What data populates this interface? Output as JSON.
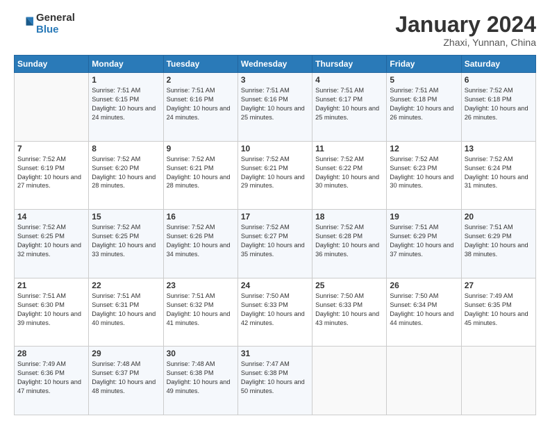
{
  "header": {
    "logo_line1": "General",
    "logo_line2": "Blue",
    "month_title": "January 2024",
    "location": "Zhaxi, Yunnan, China"
  },
  "days_of_week": [
    "Sunday",
    "Monday",
    "Tuesday",
    "Wednesday",
    "Thursday",
    "Friday",
    "Saturday"
  ],
  "weeks": [
    [
      {
        "day": "",
        "sunrise": "",
        "sunset": "",
        "daylight": ""
      },
      {
        "day": "1",
        "sunrise": "Sunrise: 7:51 AM",
        "sunset": "Sunset: 6:15 PM",
        "daylight": "Daylight: 10 hours and 24 minutes."
      },
      {
        "day": "2",
        "sunrise": "Sunrise: 7:51 AM",
        "sunset": "Sunset: 6:16 PM",
        "daylight": "Daylight: 10 hours and 24 minutes."
      },
      {
        "day": "3",
        "sunrise": "Sunrise: 7:51 AM",
        "sunset": "Sunset: 6:16 PM",
        "daylight": "Daylight: 10 hours and 25 minutes."
      },
      {
        "day": "4",
        "sunrise": "Sunrise: 7:51 AM",
        "sunset": "Sunset: 6:17 PM",
        "daylight": "Daylight: 10 hours and 25 minutes."
      },
      {
        "day": "5",
        "sunrise": "Sunrise: 7:51 AM",
        "sunset": "Sunset: 6:18 PM",
        "daylight": "Daylight: 10 hours and 26 minutes."
      },
      {
        "day": "6",
        "sunrise": "Sunrise: 7:52 AM",
        "sunset": "Sunset: 6:18 PM",
        "daylight": "Daylight: 10 hours and 26 minutes."
      }
    ],
    [
      {
        "day": "7",
        "sunrise": "Sunrise: 7:52 AM",
        "sunset": "Sunset: 6:19 PM",
        "daylight": "Daylight: 10 hours and 27 minutes."
      },
      {
        "day": "8",
        "sunrise": "Sunrise: 7:52 AM",
        "sunset": "Sunset: 6:20 PM",
        "daylight": "Daylight: 10 hours and 28 minutes."
      },
      {
        "day": "9",
        "sunrise": "Sunrise: 7:52 AM",
        "sunset": "Sunset: 6:21 PM",
        "daylight": "Daylight: 10 hours and 28 minutes."
      },
      {
        "day": "10",
        "sunrise": "Sunrise: 7:52 AM",
        "sunset": "Sunset: 6:21 PM",
        "daylight": "Daylight: 10 hours and 29 minutes."
      },
      {
        "day": "11",
        "sunrise": "Sunrise: 7:52 AM",
        "sunset": "Sunset: 6:22 PM",
        "daylight": "Daylight: 10 hours and 30 minutes."
      },
      {
        "day": "12",
        "sunrise": "Sunrise: 7:52 AM",
        "sunset": "Sunset: 6:23 PM",
        "daylight": "Daylight: 10 hours and 30 minutes."
      },
      {
        "day": "13",
        "sunrise": "Sunrise: 7:52 AM",
        "sunset": "Sunset: 6:24 PM",
        "daylight": "Daylight: 10 hours and 31 minutes."
      }
    ],
    [
      {
        "day": "14",
        "sunrise": "Sunrise: 7:52 AM",
        "sunset": "Sunset: 6:25 PM",
        "daylight": "Daylight: 10 hours and 32 minutes."
      },
      {
        "day": "15",
        "sunrise": "Sunrise: 7:52 AM",
        "sunset": "Sunset: 6:25 PM",
        "daylight": "Daylight: 10 hours and 33 minutes."
      },
      {
        "day": "16",
        "sunrise": "Sunrise: 7:52 AM",
        "sunset": "Sunset: 6:26 PM",
        "daylight": "Daylight: 10 hours and 34 minutes."
      },
      {
        "day": "17",
        "sunrise": "Sunrise: 7:52 AM",
        "sunset": "Sunset: 6:27 PM",
        "daylight": "Daylight: 10 hours and 35 minutes."
      },
      {
        "day": "18",
        "sunrise": "Sunrise: 7:52 AM",
        "sunset": "Sunset: 6:28 PM",
        "daylight": "Daylight: 10 hours and 36 minutes."
      },
      {
        "day": "19",
        "sunrise": "Sunrise: 7:51 AM",
        "sunset": "Sunset: 6:29 PM",
        "daylight": "Daylight: 10 hours and 37 minutes."
      },
      {
        "day": "20",
        "sunrise": "Sunrise: 7:51 AM",
        "sunset": "Sunset: 6:29 PM",
        "daylight": "Daylight: 10 hours and 38 minutes."
      }
    ],
    [
      {
        "day": "21",
        "sunrise": "Sunrise: 7:51 AM",
        "sunset": "Sunset: 6:30 PM",
        "daylight": "Daylight: 10 hours and 39 minutes."
      },
      {
        "day": "22",
        "sunrise": "Sunrise: 7:51 AM",
        "sunset": "Sunset: 6:31 PM",
        "daylight": "Daylight: 10 hours and 40 minutes."
      },
      {
        "day": "23",
        "sunrise": "Sunrise: 7:51 AM",
        "sunset": "Sunset: 6:32 PM",
        "daylight": "Daylight: 10 hours and 41 minutes."
      },
      {
        "day": "24",
        "sunrise": "Sunrise: 7:50 AM",
        "sunset": "Sunset: 6:33 PM",
        "daylight": "Daylight: 10 hours and 42 minutes."
      },
      {
        "day": "25",
        "sunrise": "Sunrise: 7:50 AM",
        "sunset": "Sunset: 6:33 PM",
        "daylight": "Daylight: 10 hours and 43 minutes."
      },
      {
        "day": "26",
        "sunrise": "Sunrise: 7:50 AM",
        "sunset": "Sunset: 6:34 PM",
        "daylight": "Daylight: 10 hours and 44 minutes."
      },
      {
        "day": "27",
        "sunrise": "Sunrise: 7:49 AM",
        "sunset": "Sunset: 6:35 PM",
        "daylight": "Daylight: 10 hours and 45 minutes."
      }
    ],
    [
      {
        "day": "28",
        "sunrise": "Sunrise: 7:49 AM",
        "sunset": "Sunset: 6:36 PM",
        "daylight": "Daylight: 10 hours and 47 minutes."
      },
      {
        "day": "29",
        "sunrise": "Sunrise: 7:48 AM",
        "sunset": "Sunset: 6:37 PM",
        "daylight": "Daylight: 10 hours and 48 minutes."
      },
      {
        "day": "30",
        "sunrise": "Sunrise: 7:48 AM",
        "sunset": "Sunset: 6:38 PM",
        "daylight": "Daylight: 10 hours and 49 minutes."
      },
      {
        "day": "31",
        "sunrise": "Sunrise: 7:47 AM",
        "sunset": "Sunset: 6:38 PM",
        "daylight": "Daylight: 10 hours and 50 minutes."
      },
      {
        "day": "",
        "sunrise": "",
        "sunset": "",
        "daylight": ""
      },
      {
        "day": "",
        "sunrise": "",
        "sunset": "",
        "daylight": ""
      },
      {
        "day": "",
        "sunrise": "",
        "sunset": "",
        "daylight": ""
      }
    ]
  ]
}
